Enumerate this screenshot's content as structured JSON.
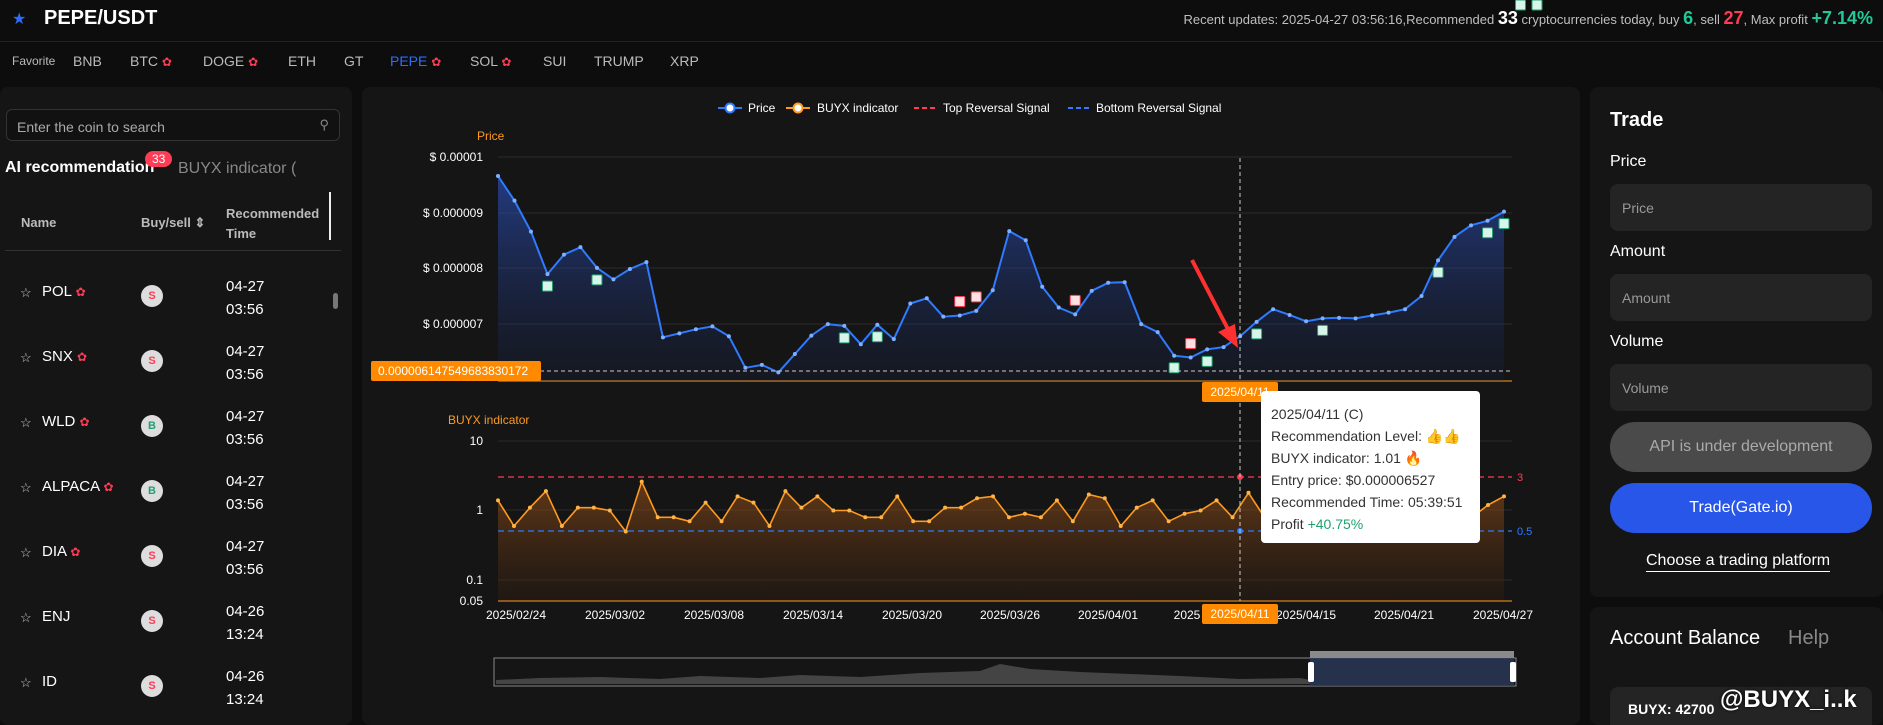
{
  "header": {
    "pair": "PEPE/USDT",
    "updates_prefix": "Recent updates: 2025-04-27 03:56:16,Recommended ",
    "recommended_count": "33",
    "updates_mid": " cryptocurrencies today, buy ",
    "buy_count": "6",
    "updates_sell": ", sell ",
    "sell_count": "27",
    "updates_profit": ", Max profit ",
    "max_profit": "+7.14%"
  },
  "favorites": {
    "label": "Favorite",
    "items": [
      {
        "name": "BNB",
        "hot": false
      },
      {
        "name": "BTC",
        "hot": true
      },
      {
        "name": "DOGE",
        "hot": true
      },
      {
        "name": "ETH",
        "hot": false
      },
      {
        "name": "GT",
        "hot": false
      },
      {
        "name": "PEPE",
        "hot": true,
        "active": true
      },
      {
        "name": "SOL",
        "hot": true
      },
      {
        "name": "SUI",
        "hot": false
      },
      {
        "name": "TRUMP",
        "hot": false
      },
      {
        "name": "XRP",
        "hot": false
      }
    ]
  },
  "left": {
    "search_placeholder": "Enter the coin to search",
    "tab_ai": "AI recommendation",
    "tab_badge": "33",
    "tab_buyx": "BUYX indicator (",
    "col_name": "Name",
    "col_buysell": "Buy/sell ⇕",
    "col_time": "Recommended Time",
    "rows": [
      {
        "name": "POL",
        "hot": true,
        "sig": "S",
        "date": "04-27",
        "time": "03:56"
      },
      {
        "name": "SNX",
        "hot": true,
        "sig": "S",
        "date": "04-27",
        "time": "03:56"
      },
      {
        "name": "WLD",
        "hot": true,
        "sig": "B",
        "date": "04-27",
        "time": "03:56"
      },
      {
        "name": "ALPACA",
        "hot": true,
        "sig": "B",
        "date": "04-27",
        "time": "03:56"
      },
      {
        "name": "DIA",
        "hot": true,
        "sig": "S",
        "date": "04-27",
        "time": "03:56"
      },
      {
        "name": "ENJ",
        "hot": false,
        "sig": "S",
        "date": "04-26",
        "time": "13:24"
      },
      {
        "name": "ID",
        "hot": false,
        "sig": "S",
        "date": "04-26",
        "time": "13:24"
      }
    ]
  },
  "chart_data": {
    "type": "line",
    "legend": [
      "Price",
      "BUYX indicator",
      "Top Reversal Signal",
      "Bottom Reversal Signal"
    ],
    "legend_placement": "top-center",
    "price_axis_label": "Price",
    "indicator_axis_label": "BUYX indicator",
    "price_ticks": [
      "$ 0.00001",
      "$ 0.000009",
      "$ 0.000008",
      "$ 0.000007"
    ],
    "indicator_ticks": [
      "10",
      "1",
      "0.1",
      "0.05"
    ],
    "x_ticks": [
      "2025/02/24",
      "2025/03/02",
      "2025/03/08",
      "2025/03/14",
      "2025/03/20",
      "2025/03/26",
      "2025/04/01",
      "2025",
      "2025/04/15",
      "2025/04/21",
      "2025/04/27"
    ],
    "crosshair_price_label": "0.000006147549683830172",
    "crosshair_date_label": "2025/04/11",
    "top_threshold": "3",
    "bottom_threshold": "0.5",
    "price_ylim": [
      6.1e-06,
      1e-05
    ],
    "indicator_ylim": [
      0.05,
      10
    ],
    "indicator_scale": "log",
    "price_values": [
      9.67e-06,
      9.24e-06,
      8.7e-06,
      7.96e-06,
      8.3e-06,
      8.43e-06,
      8.07e-06,
      7.87e-06,
      8.05e-06,
      8.17e-06,
      6.86e-06,
      6.93e-06,
      7e-06,
      7.05e-06,
      6.88e-06,
      6.33e-06,
      6.38e-06,
      6.25e-06,
      6.57e-06,
      6.89e-06,
      7.09e-06,
      7.06e-06,
      6.74e-06,
      7.08e-06,
      6.83e-06,
      7.45e-06,
      7.54e-06,
      7.22e-06,
      7.24e-06,
      7.32e-06,
      7.68e-06,
      8.71e-06,
      8.55e-06,
      7.74e-06,
      7.38e-06,
      7.26e-06,
      7.67e-06,
      7.81e-06,
      7.82e-06,
      7.09e-06,
      6.95e-06,
      6.54e-06,
      6.51e-06,
      6.65e-06,
      6.69e-06,
      6.88e-06,
      7.13e-06,
      7.35e-06,
      7.25e-06,
      7.14e-06,
      7.19e-06,
      7.2e-06,
      7.19e-06,
      7.24e-06,
      7.29e-06,
      7.35e-06,
      7.58e-06,
      8.2e-06,
      8.61e-06,
      8.81e-06,
      8.89e-06,
      9.05e-06
    ],
    "indicator_values": [
      1.4,
      0.6,
      1.1,
      1.9,
      0.6,
      1.1,
      1.1,
      1.0,
      0.5,
      2.6,
      0.8,
      0.8,
      0.7,
      1.3,
      0.7,
      1.6,
      1.3,
      0.6,
      1.9,
      1.1,
      1.6,
      1.0,
      1.0,
      0.8,
      0.8,
      1.6,
      0.7,
      0.7,
      1.1,
      1.1,
      1.5,
      1.6,
      0.8,
      0.9,
      0.8,
      1.4,
      0.7,
      1.7,
      1.5,
      0.6,
      1.1,
      1.4,
      0.7,
      0.9,
      1.0,
      1.4,
      0.8,
      1.8,
      0.8,
      1.2,
      1.7,
      1.1,
      0.6,
      1.2,
      1.1,
      0.8,
      0.5,
      5.0,
      0.5,
      1.0,
      1.5,
      0.8,
      1.2,
      1.6
    ],
    "buy_markers": [
      3,
      6,
      21,
      23,
      41,
      43,
      46,
      50,
      57,
      60,
      61,
      62,
      63
    ],
    "sell_markers": [
      28,
      29,
      35,
      42
    ],
    "highlight_index": 44
  },
  "tooltip": {
    "date": "2025/04/11 (C)",
    "level_label": "Recommendation Level: ",
    "indicator_label": "BUYX indicator: 1.01",
    "entry": "Entry price: $0.000006527",
    "rec_time": "Recommended Time: 05:39:51",
    "profit_label": "Profit ",
    "profit_value": "+40.75%"
  },
  "trade": {
    "title": "Trade",
    "price_label": "Price",
    "price_placeholder": "Price",
    "amount_label": "Amount",
    "amount_placeholder": "Amount",
    "volume_label": "Volume",
    "volume_placeholder": "Volume",
    "api_button": "API is under development",
    "trade_button": "Trade(Gate.io)",
    "platform_link": "Choose a trading platform"
  },
  "account": {
    "title": "Account Balance",
    "help": "Help",
    "balance": "BUYX: 42700"
  },
  "watermark": "@BUYX_i..k",
  "colors": {
    "accent": "#2f6bff",
    "buy": "#20c997",
    "sell": "#ff3b55",
    "price_line": "#2f7bff",
    "indicator_line": "#ff9a1f"
  }
}
